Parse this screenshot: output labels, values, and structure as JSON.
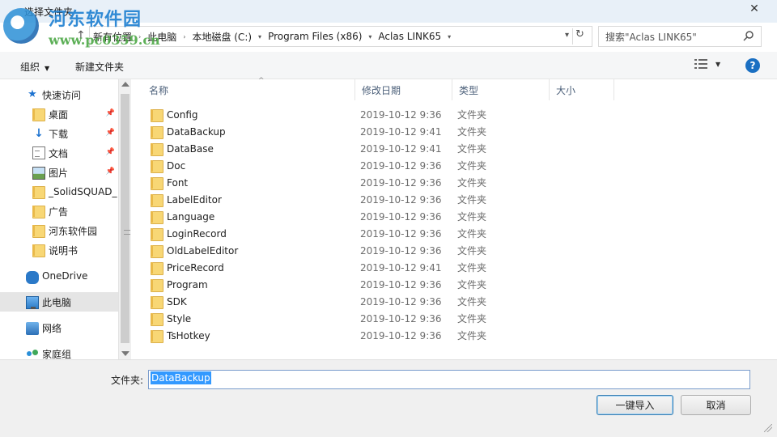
{
  "window": {
    "title": "选择文件夹",
    "watermark_text": "河东软件园",
    "watermark_url": "www.pc0359.cn"
  },
  "address": {
    "crumbs": [
      "新有位置",
      "此电脑",
      "本地磁盘 (C:)",
      "Program Files (x86)",
      "Aclas LINK65"
    ],
    "search_placeholder": "搜索\"Aclas LINK65\""
  },
  "toolbar": {
    "organize": "组织",
    "new_folder": "新建文件夹"
  },
  "nav": {
    "items": [
      {
        "label": "快速访问",
        "icon": "star-icon"
      },
      {
        "label": "桌面",
        "icon": "folder-icon",
        "pinned": true
      },
      {
        "label": "下载",
        "icon": "download-icon",
        "pinned": true
      },
      {
        "label": "文档",
        "icon": "document-icon",
        "pinned": true
      },
      {
        "label": "图片",
        "icon": "pictures-icon",
        "pinned": true
      },
      {
        "label": "_SolidSQUAD_",
        "icon": "folder-icon"
      },
      {
        "label": "广告",
        "icon": "folder-icon"
      },
      {
        "label": "河东软件园",
        "icon": "folder-icon"
      },
      {
        "label": "说明书",
        "icon": "folder-icon"
      },
      {
        "label": "OneDrive",
        "icon": "cloud-icon"
      },
      {
        "label": "此电脑",
        "icon": "computer-icon"
      },
      {
        "label": "网络",
        "icon": "network-icon"
      },
      {
        "label": "家庭组",
        "icon": "homegroup-icon"
      }
    ]
  },
  "columns": [
    "名称",
    "修改日期",
    "类型",
    "大小"
  ],
  "files": [
    {
      "name": "Config",
      "date": "2019-10-12 9:36",
      "type": "文件夹"
    },
    {
      "name": "DataBackup",
      "date": "2019-10-12 9:41",
      "type": "文件夹"
    },
    {
      "name": "DataBase",
      "date": "2019-10-12 9:41",
      "type": "文件夹"
    },
    {
      "name": "Doc",
      "date": "2019-10-12 9:36",
      "type": "文件夹"
    },
    {
      "name": "Font",
      "date": "2019-10-12 9:36",
      "type": "文件夹"
    },
    {
      "name": "LabelEditor",
      "date": "2019-10-12 9:36",
      "type": "文件夹"
    },
    {
      "name": "Language",
      "date": "2019-10-12 9:36",
      "type": "文件夹"
    },
    {
      "name": "LoginRecord",
      "date": "2019-10-12 9:36",
      "type": "文件夹"
    },
    {
      "name": "OldLabelEditor",
      "date": "2019-10-12 9:36",
      "type": "文件夹"
    },
    {
      "name": "PriceRecord",
      "date": "2019-10-12 9:41",
      "type": "文件夹"
    },
    {
      "name": "Program",
      "date": "2019-10-12 9:36",
      "type": "文件夹"
    },
    {
      "name": "SDK",
      "date": "2019-10-12 9:36",
      "type": "文件夹"
    },
    {
      "name": "Style",
      "date": "2019-10-12 9:36",
      "type": "文件夹"
    },
    {
      "name": "TsHotkey",
      "date": "2019-10-12 9:36",
      "type": "文件夹"
    }
  ],
  "bottom": {
    "folder_label": "文件夹:",
    "folder_value": "DataBackup",
    "import_button": "一键导入",
    "cancel_button": "取消"
  },
  "colors": {
    "accent": "#1a6fc2",
    "selection": "#3399ff",
    "folder": "#f8d775"
  }
}
